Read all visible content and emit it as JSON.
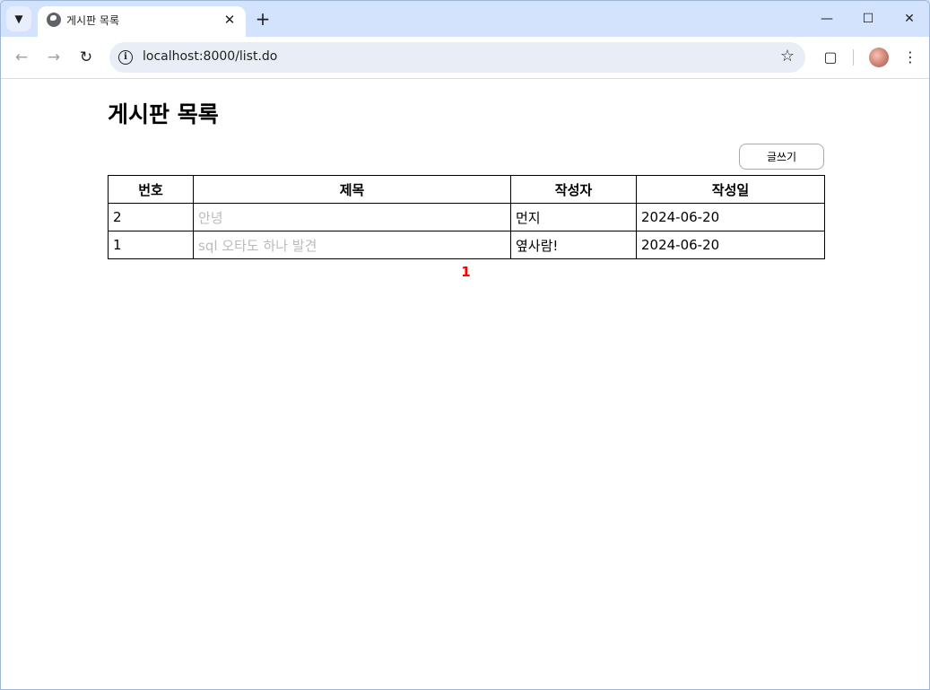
{
  "browser": {
    "tab_title": "게시판 목록",
    "url": "localhost:8000/list.do"
  },
  "page": {
    "title": "게시판 목록",
    "write_button": "글쓰기",
    "table": {
      "headers": [
        "번호",
        "제목",
        "작성자",
        "작성일"
      ],
      "rows": [
        {
          "num": "2",
          "title": "안녕",
          "writer": "먼지",
          "date": "2024-06-20"
        },
        {
          "num": "1",
          "title": "sql 오타도 하나 발견",
          "writer": "옆사람!",
          "date": "2024-06-20"
        }
      ]
    },
    "pagination": {
      "current": "1"
    }
  },
  "icons": {
    "tab_search": "chevron-down-icon",
    "favicon": "globe-icon",
    "tab_close": "close-icon",
    "new_tab": "plus-icon",
    "back": "arrow-left-icon",
    "forward": "arrow-right-icon",
    "reload": "reload-icon",
    "site_info": "info-icon",
    "bookmark": "star-icon",
    "extensions": "puzzle-icon",
    "menu": "kebab-menu-icon"
  },
  "colors": {
    "title_link": "#bbbbbb",
    "pagination_current": "#ff0000",
    "tabstrip_bg": "#d3e3fd"
  }
}
